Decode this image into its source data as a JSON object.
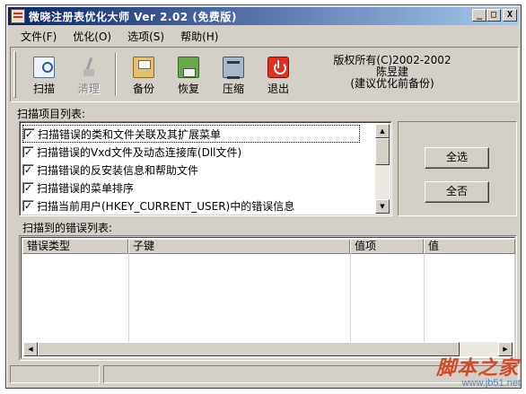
{
  "window": {
    "title": "微晓注册表优化大师 Ver 2.02 (免费版)",
    "controls": {
      "minimize": "_",
      "maximize": "□",
      "close": "X"
    }
  },
  "menu": [
    {
      "label": "文件(F)"
    },
    {
      "label": "优化(O)"
    },
    {
      "label": "选项(S)"
    },
    {
      "label": "帮助(H)"
    }
  ],
  "toolbar": {
    "tools": [
      {
        "label": "扫描",
        "icon": "scan-icon",
        "enabled": true
      },
      {
        "label": "清理",
        "icon": "clean-icon",
        "enabled": false
      },
      {
        "label": "备份",
        "icon": "backup-icon",
        "enabled": true
      },
      {
        "label": "恢复",
        "icon": "restore-icon",
        "enabled": true
      },
      {
        "label": "压缩",
        "icon": "compress-icon",
        "enabled": true
      },
      {
        "label": "退出",
        "icon": "exit-icon",
        "enabled": true
      }
    ],
    "copyright": {
      "line1": "版权所有(C)2002-2002",
      "line2": "陈昱建",
      "line3": "(建议优化前备份)"
    }
  },
  "scan_items": {
    "label": "扫描项目列表:",
    "items": [
      {
        "text": "扫描错误的类和文件关联及其扩展菜单",
        "checked": true
      },
      {
        "text": "扫描错误的Vxd文件及动态连接库(Dll文件)",
        "checked": true
      },
      {
        "text": "扫描错误的反安装信息和帮助文件",
        "checked": true
      },
      {
        "text": "扫描错误的菜单排序",
        "checked": true
      },
      {
        "text": "扫描当前用户(HKEY_CURRENT_USER)中的错误信息",
        "checked": true
      }
    ],
    "select_all_label": "全选",
    "select_none_label": "全否"
  },
  "errors": {
    "label": "扫描到的错误列表:",
    "columns": [
      "错误类型",
      "子键",
      "值项",
      "值"
    ],
    "rows": []
  },
  "statusbar": {
    "left": "",
    "right": ""
  },
  "watermark": {
    "main": "脚本之家",
    "sub": "www.jb51.net"
  },
  "colors": {
    "title_start": "#0a246a",
    "title_end": "#a6caf0",
    "face": "#d4d0c8"
  }
}
